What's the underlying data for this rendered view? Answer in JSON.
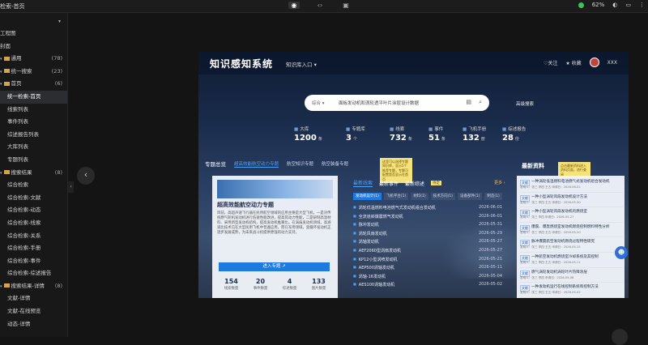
{
  "topbar": {
    "title": "检索-首页",
    "battery": "62%"
  },
  "sidebar": {
    "items": [
      {
        "label": "工程图",
        "count": "",
        "level": 1,
        "type": "plain"
      },
      {
        "label": "封面",
        "count": "",
        "level": 1,
        "type": "plain"
      },
      {
        "label": "通用",
        "count": "(78)",
        "level": 1,
        "type": "folder"
      },
      {
        "label": "统一搜索",
        "count": "(23)",
        "level": 1,
        "type": "folder"
      },
      {
        "label": "首页",
        "count": "(6)",
        "level": 1,
        "type": "folder"
      },
      {
        "label": "统一检索-首页",
        "count": "",
        "level": 2,
        "type": "active"
      },
      {
        "label": "线索列表",
        "count": "",
        "level": 2,
        "type": "plain"
      },
      {
        "label": "事件列表",
        "count": "",
        "level": 2,
        "type": "plain"
      },
      {
        "label": "综述报告列表",
        "count": "",
        "level": 2,
        "type": "plain"
      },
      {
        "label": "大库列表",
        "count": "",
        "level": 2,
        "type": "plain"
      },
      {
        "label": "专题列表",
        "count": "",
        "level": 2,
        "type": "plain"
      },
      {
        "label": "搜索结果",
        "count": "(8)",
        "level": 1,
        "type": "folder"
      },
      {
        "label": "综合检索",
        "count": "",
        "level": 2,
        "type": "plain"
      },
      {
        "label": "综合检索-文献",
        "count": "",
        "level": 2,
        "type": "plain"
      },
      {
        "label": "综合检索-动态",
        "count": "",
        "level": 2,
        "type": "plain"
      },
      {
        "label": "综合检索-线索",
        "count": "",
        "level": 2,
        "type": "plain"
      },
      {
        "label": "综合检索-关系",
        "count": "",
        "level": 2,
        "type": "plain"
      },
      {
        "label": "综合检索-手册",
        "count": "",
        "level": 2,
        "type": "plain"
      },
      {
        "label": "综合检索-事件",
        "count": "",
        "level": 2,
        "type": "plain"
      },
      {
        "label": "综合检索-综述报告",
        "count": "",
        "level": 2,
        "type": "plain"
      },
      {
        "label": "搜索结果-详情",
        "count": "(8)",
        "level": 1,
        "type": "folder"
      },
      {
        "label": "文献-详情",
        "count": "",
        "level": 2,
        "type": "plain"
      },
      {
        "label": "文献-在线预览",
        "count": "",
        "level": 2,
        "type": "plain"
      },
      {
        "label": "动态-详情",
        "count": "",
        "level": 2,
        "type": "plain"
      }
    ]
  },
  "app": {
    "logo": "知识感知系统",
    "lib_entry": "知识库入口",
    "hdr_fav": "关注",
    "hdr_collect": "收藏",
    "user": "XXX",
    "search_scope": "综合",
    "search_text": "面板发动机和涡轮透平叶片涂层设计数据",
    "adv_search": "高级搜索",
    "stats": [
      {
        "label": "大库",
        "value": "1200",
        "unit": "条"
      },
      {
        "label": "专题库",
        "value": "3",
        "unit": "个"
      },
      {
        "label": "线索",
        "value": "732",
        "unit": "条"
      },
      {
        "label": "事件",
        "value": "51",
        "unit": "条"
      },
      {
        "label": "飞机手册",
        "value": "132",
        "unit": "册"
      },
      {
        "label": "综述报告",
        "value": "28",
        "unit": "份"
      }
    ],
    "section_title": "专题总览",
    "section_tabs": [
      "超高效能航空动力专题",
      "航空知识专题",
      "航空装备专题"
    ],
    "sticky_left": "这里可以选择专题知识库，显示5个推荐专题，专题可配置是否显示在首页",
    "sticky_right": "点击最新资料进入资料页面，进行查阅",
    "panel": {
      "title": "超高效能航空动力专题",
      "desc": "目前，高超声速飞行器在民用航空领域的应用主要是大型飞机，一是对传统燃气轮机发动机进行低速性能改进，提高其动力性能，二是研制高温材料、采用新型发动机结构，提高发动机推重比。在涡扇发动机领域，高涵道比技术已在大型民用飞机中普遍应用，而在军用领域，变循环发动机正逐步发展成熟，为未来战斗机提供更强的动力支持。",
      "btn": "进入专题 ↗",
      "kpis": [
        {
          "n": "154",
          "l": "线索数量"
        },
        {
          "n": "20",
          "l": "事件数量"
        },
        {
          "n": "4",
          "l": "综述数量"
        },
        {
          "n": "133",
          "l": "图片数量"
        }
      ]
    },
    "mid_tabs": [
      "最新线索",
      "最新事件",
      "最新综述"
    ],
    "mid_badge": "待定",
    "more": "更多 ›",
    "chips": [
      "发动机设计(1)",
      "飞机平台(1)",
      "材料(1)",
      "技术方向(1)",
      "设备部件(1)",
      "制造(1)"
    ],
    "rows": [
      {
        "t": "涡轮低温燃料电池燃气式发动机组合发动机",
        "d": "2026-06-01"
      },
      {
        "t": "全流道斜爆震燃气发动机",
        "d": "2026-06-01"
      },
      {
        "t": "脉冲发动机",
        "d": "2026-05-31"
      },
      {
        "t": "涡轮风扇发动机",
        "d": "2026-05-29"
      },
      {
        "t": "涡轴发动机",
        "d": "2026-05-27"
      },
      {
        "t": "AEF2060型涡扇发动机",
        "d": "2026-05-27"
      },
      {
        "t": "KP12小型涡喷发动机",
        "d": "2026-05-21"
      },
      {
        "t": "AEP500涡轴发动机",
        "d": "2026-05-11"
      },
      {
        "t": "涡轴-16发动机",
        "d": "2026-05-04"
      },
      {
        "t": "AES100涡轴发动机",
        "d": "2026-05-02"
      }
    ],
    "rt_title": "最新资料",
    "ritems": [
      {
        "tag": "文献",
        "h": "一种涡轮低温燃料电池燃气式发动机组合发动机",
        "s": "发明人：张三 李四 王五 申请日：2026-06-01"
      },
      {
        "tag": "文献",
        "h": "一种小型涡轮风扇发动机设计方法",
        "s": "发明人：张三 李四 王五 申请日：2026-05-30"
      },
      {
        "tag": "文献",
        "h": "一种小型涡轮风扇发动机的燃烧室",
        "s": "发明人：张三 李四 申请日：2026-05-27"
      },
      {
        "tag": "文献",
        "h": "爆震、爆轰燃烧室发动机燃烧控制燃料特性分析",
        "s": "发明人：张三 李四 王五 申请日：2026-05-20"
      },
      {
        "tag": "文献",
        "h": "脉冲爆震航空发动机燃烧过程特性研究",
        "s": "发明人：张三 李四 王五 申请日：2026-05-15"
      },
      {
        "tag": "文献",
        "h": "一种航空发动机燃烧室冷却系统及其控制",
        "s": "发明人：张三 李四 王五 申请日：2026-05-11"
      },
      {
        "tag": "文献",
        "h": "燃气涡轮发动机涡轮叶片热障涂层",
        "s": "发明人：张三 李四 申请日：2026-05-08"
      },
      {
        "tag": "文献",
        "h": "一种发动机运行在线控制系统和控制方法",
        "s": "发明人：张三 李四 王五 申请日：2026-05-02"
      }
    ]
  }
}
